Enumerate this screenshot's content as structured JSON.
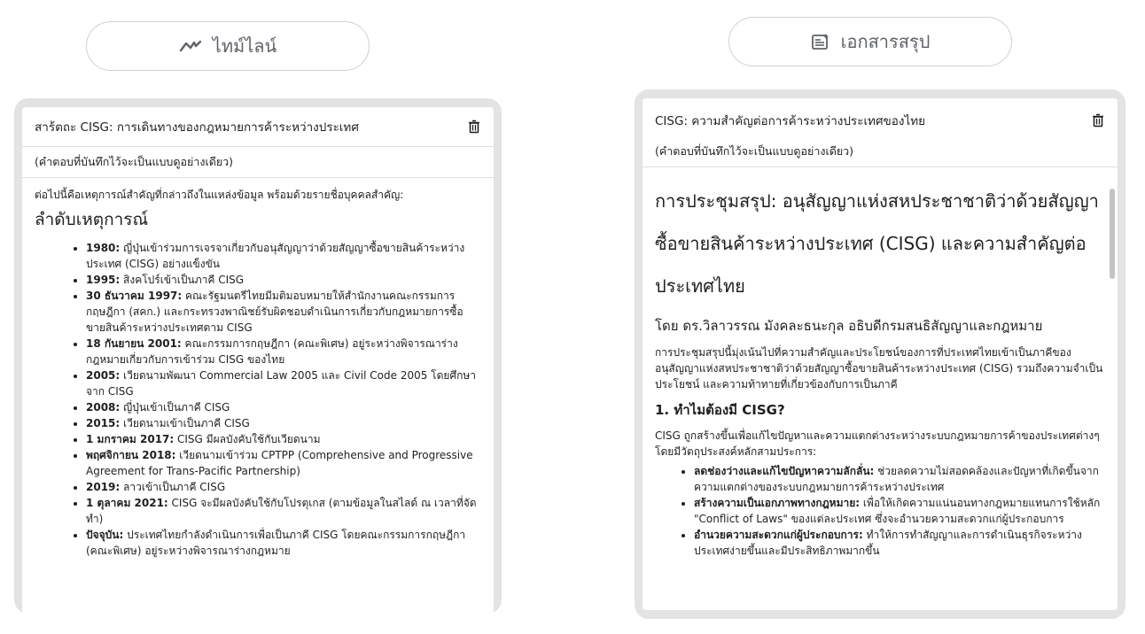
{
  "tabs": {
    "timeline_label": "ไทม์ไลน์",
    "summary_label": "เอกสารสรุป"
  },
  "left_card": {
    "title": "สาร้ตถะ CISG: การเดินทางของกฎหมายการค้าระหว่างประเทศ",
    "note": "(คำตอบที่บันทึกไว้จะเป็นแบบดูอย่างเดียว)",
    "intro": "ต่อไปนี้คือเหตุการณ์สำคัญที่กล่าวถึงในแหล่งข้อมูล พร้อมด้วยรายชื่อบุคคลสำคัญ:",
    "heading": "ลำดับเหตุการณ์",
    "events": [
      {
        "date": "1980:",
        "text": " ญี่ปุ่นเข้าร่วมการเจรจาเกี่ยวกับอนุสัญญาว่าด้วยสัญญาซื้อขายสินค้าระหว่างประเทศ (CISG) อย่างแข็งขัน"
      },
      {
        "date": "1995:",
        "text": " สิงคโปร์เข้าเป็นภาคี CISG"
      },
      {
        "date": "30 ธันวาคม 1997:",
        "text": " คณะรัฐมนตรีไทยมีมติมอบหมายให้สำนักงานคณะกรรมการกฤษฎีกา (สคก.) และกระทรวงพาณิชย์รับผิดชอบดำเนินการเกี่ยวกับกฎหมายการซื้อขายสินค้าระหว่างประเทศตาม CISG"
      },
      {
        "date": "18 กันยายน 2001:",
        "text": " คณะกรรมการกฤษฎีกา (คณะพิเศษ) อยู่ระหว่างพิจารณาร่างกฎหมายเกี่ยวกับการเข้าร่วม CISG ของไทย"
      },
      {
        "date": "2005:",
        "text": " เวียดนามพัฒนา Commercial Law 2005 และ Civil Code 2005 โดยศึกษาจาก CISG"
      },
      {
        "date": "2008:",
        "text": " ญี่ปุ่นเข้าเป็นภาคี CISG"
      },
      {
        "date": "2015:",
        "text": " เวียดนามเข้าเป็นภาคี CISG"
      },
      {
        "date": "1 มกราคม 2017:",
        "text": " CISG มีผลบังคับใช้กับเวียดนาม"
      },
      {
        "date": "พฤศจิกายน 2018:",
        "text": " เวียดนามเข้าร่วม CPTPP (Comprehensive and Progressive Agreement for Trans-Pacific Partnership)"
      },
      {
        "date": "2019:",
        "text": " ลาวเข้าเป็นภาคี CISG"
      },
      {
        "date": "1 ตุลาคม 2021:",
        "text": " CISG จะมีผลบังคับใช้กับโปรตุเกส (ตามข้อมูลในสไลด์ ณ เวลาที่จัดทำ)"
      },
      {
        "date": "ปัจจุบัน:",
        "text": " ประเทศไทยกำลังดำเนินการเพื่อเป็นภาคี CISG โดยคณะกรรมการกฤษฎีกา (คณะพิเศษ) อยู่ระหว่างพิจารณาร่างกฎหมาย"
      }
    ]
  },
  "right_card": {
    "title": "CISG: ความสำคัญต่อการค้าระหว่างประเทศของไทย",
    "note": "(คำตอบที่บันทึกไว้จะเป็นแบบดูอย่างเดียว)",
    "doc_title": "การประชุมสรุป: อนุสัญญาแห่งสหประชาชาติว่าด้วยสัญญาซื้อขายสินค้าระหว่างประเทศ (CISG) และความสำคัญต่อประเทศไทย",
    "byline": "โดย ดร.วิลาวรรณ มังคละธนะกุล อธิบดีกรมสนธิสัญญาและกฎหมาย",
    "summary": "การประชุมสรุปนี้มุ่งเน้นไปที่ความสำคัญและประโยชน์ของการที่ประเทศไทยเข้าเป็นภาคีของอนุสัญญาแห่งสหประชาชาติว่าด้วยสัญญาซื้อขายสินค้าระหว่างประเทศ (CISG) รวมถึงความจำเป็น ประโยชน์ และความท้าทายที่เกี่ยวข้องกับการเป็นภาคี",
    "section1_heading": "1. ทำไมต้องมี CISG?",
    "section1_text": "CISG ถูกสร้างขึ้นเพื่อแก้ไขปัญหาและความแตกต่างระหว่างระบบกฎหมายการค้าของประเทศต่างๆ โดยมีวัตถุประสงค์หลักสามประการ:",
    "bullets": [
      {
        "bold": "ลดช่องว่างและแก้ไขปัญหาความลักลั่น:",
        "text": " ช่วยลดความไม่สอดคล้องและปัญหาที่เกิดขึ้นจากความแตกต่างของระบบกฎหมายการค้าระหว่างประเทศ"
      },
      {
        "bold": "สร้างความเป็นเอกภาพทางกฎหมาย:",
        "text": " เพื่อให้เกิดความแน่นอนทางกฎหมายแทนการใช้หลัก \"Conflict of Laws\" ของแต่ละประเทศ ซึ่งจะอำนวยความสะดวกแก่ผู้ประกอบการ"
      },
      {
        "bold": "อำนวยความสะดวกแก่ผู้ประกอบการ:",
        "text": " ทำให้การทำสัญญาและการดำเนินธุรกิจระหว่างประเทศง่ายขึ้นและมีประสิทธิภาพมากขึ้น"
      }
    ]
  }
}
